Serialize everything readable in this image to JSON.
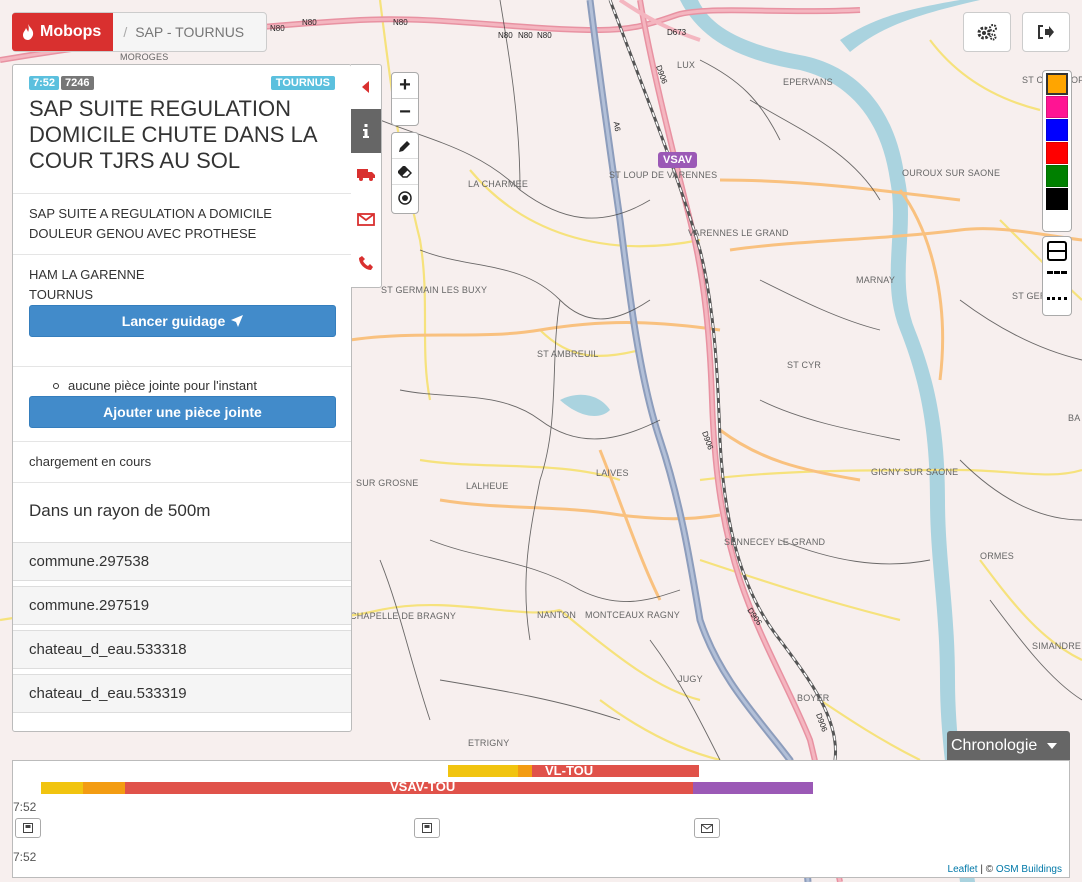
{
  "app": {
    "brand": "Mobops",
    "breadcrumb": "SAP - TOURNUS"
  },
  "incident": {
    "time": "7:52",
    "number": "7246",
    "city_badge": "TOURNUS",
    "title": "SAP SUITE REGULATION DOMICILE CHUTE DANS LA COUR TJRS AU SOL",
    "description": "SAP SUITE A REGULATION A DOMICILE DOULEUR GENOU AVEC PROTHESE",
    "address_line1": "HAM LA GARENNE",
    "address_line2": "TOURNUS",
    "guidance_button": "Lancer guidage",
    "attachments_empty": "aucune pièce jointe pour l'instant",
    "add_attachment_button": "Ajouter une pièce jointe",
    "loading": "chargement en cours",
    "radius_title": "Dans un rayon de 500m",
    "nearby": [
      "commune.297538",
      "commune.297519",
      "chateau_d_eau.533318",
      "chateau_d_eau.533319"
    ]
  },
  "side_tabs": [
    {
      "icon": "caret-left-icon"
    },
    {
      "icon": "info-icon",
      "active": true
    },
    {
      "icon": "truck-icon"
    },
    {
      "icon": "envelope-icon"
    },
    {
      "icon": "phone-icon"
    }
  ],
  "map": {
    "zoom_in": "+",
    "zoom_out": "−",
    "vehicle_marker": "VSAV",
    "places": [
      "MOROGES",
      "LUX",
      "EPERVANS",
      "ST CHRISTOPHE",
      "LA CHARMEE",
      "ST LOUP DE VARENNES",
      "OUROUX SUR SAONE",
      "VARENNES LE GRAND",
      "MARNAY",
      "ST GERMAIN LES BUXY",
      "ST GERMAIN",
      "ST AMBREUIL",
      "ST CYR",
      "BA",
      "LAIVES",
      "GIGNY SUR SAONE",
      "SUR GROSNE",
      "LALHEUE",
      "SENNECEY LE GRAND",
      "ORMES",
      "CHAPELLE DE BRAGNY",
      "NANTON",
      "MONTCEAUX RAGNY",
      "SIMANDRE",
      "JUGY",
      "BOYER",
      "ETRIGNY"
    ],
    "roads": [
      "N80",
      "N80",
      "N80",
      "N80",
      "N80",
      "N80",
      "D673",
      "D906",
      "D906",
      "D906",
      "D906",
      "A6"
    ]
  },
  "colors": [
    {
      "name": "orange",
      "hex": "#ffa500",
      "selected": true
    },
    {
      "name": "pink",
      "hex": "#ff1493"
    },
    {
      "name": "blue",
      "hex": "#0000ff"
    },
    {
      "name": "red",
      "hex": "#ff0000"
    },
    {
      "name": "green",
      "hex": "#008000"
    },
    {
      "name": "black",
      "hex": "#000000"
    }
  ],
  "timeline": {
    "button": "Chronologie",
    "start_time": "7:52",
    "end_time": "7:52",
    "vehicles": [
      {
        "label": "VL-TOU",
        "segments": [
          {
            "color": "#f1c40f"
          },
          {
            "color": "#f39c12"
          },
          {
            "color": "#e0524a"
          }
        ]
      },
      {
        "label": "VSAV-TOU",
        "segments": [
          {
            "color": "#f1c40f"
          },
          {
            "color": "#f39c12"
          },
          {
            "color": "#e0524a"
          },
          {
            "color": "#9b59b6"
          }
        ]
      }
    ]
  },
  "attribution": {
    "leaflet": "Leaflet",
    "sep": "| ©",
    "osm": "OSM Buildings"
  }
}
